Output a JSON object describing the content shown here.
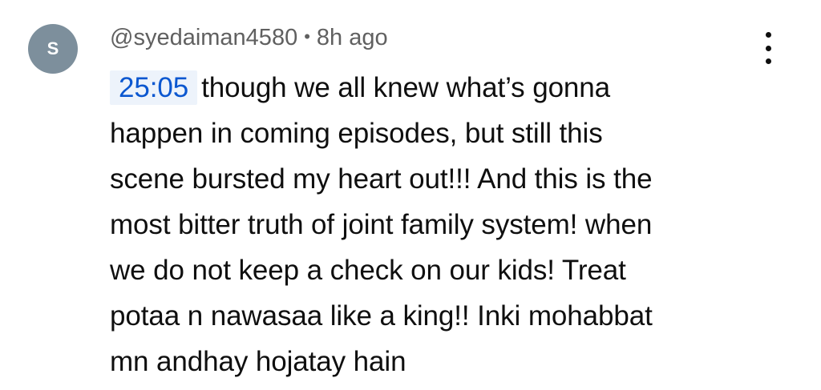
{
  "comment": {
    "avatar_initial": "S",
    "author": "@syedaiman4580",
    "separator": "•",
    "time_ago": "8h ago",
    "timestamp_link": "25:05",
    "lines": [
      "though we all knew what’s gonna",
      "happen in coming episodes, but still this",
      "scene bursted my heart out!!! And this is the",
      "most bitter truth of joint family system! when",
      "we do not keep a check on our kids! Treat",
      "potaa n nawasaa like a king!! Inki mohabbat",
      "mn andhay hojatay hain"
    ],
    "menu_icon": "more-vertical-icon"
  },
  "colors": {
    "avatar_bg": "#7d8f9c",
    "timestamp_text": "#0b57d0",
    "timestamp_bg": "#edf3fb",
    "meta_text": "#606060"
  }
}
